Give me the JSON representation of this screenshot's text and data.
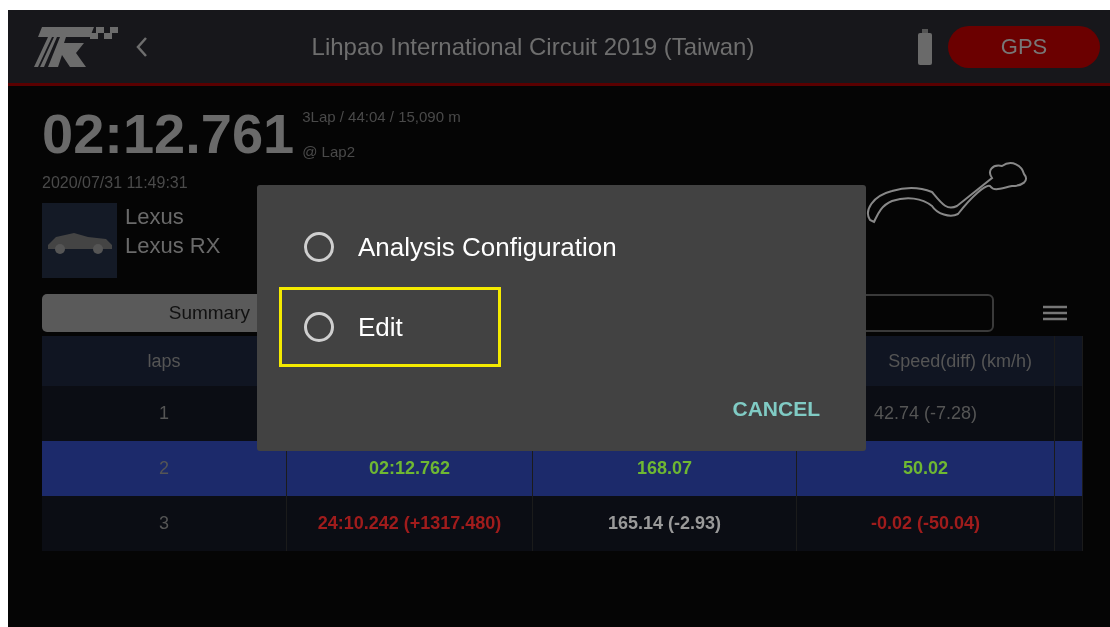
{
  "header": {
    "title": "Lihpao International Circuit 2019 (Taiwan)",
    "gps_button": "GPS"
  },
  "session": {
    "best_time": "02:12.761",
    "summary": "3Lap / 44:04 / 15,090 m",
    "best_lap": "@ Lap2",
    "date": "2020/07/31 11:49:31",
    "make": "Lexus",
    "model": "Lexus RX"
  },
  "tabs": [
    {
      "label": "Summary",
      "selected": true
    },
    {
      "selected": false
    }
  ],
  "table": {
    "columns": [
      "laps",
      null,
      null,
      "Speed(diff) (km/h)",
      null
    ],
    "rows": [
      {
        "selected": false,
        "cells": [
          {
            "text": "1"
          },
          null,
          null,
          {
            "text": "42.74 (-7.28)"
          },
          null
        ]
      },
      {
        "selected": true,
        "cells": [
          {
            "text": "2"
          },
          {
            "text": "02:12.762",
            "color": "#6fb832"
          },
          {
            "text": "168.07",
            "color": "#6fb832"
          },
          {
            "text": "50.02",
            "color": "#6fb832"
          },
          null
        ]
      },
      {
        "selected": false,
        "cells": [
          {
            "text": "3"
          },
          {
            "text": "24:10.242 (+1317.480)",
            "color": "#a01c1c"
          },
          {
            "text": "165.14 (-2.93)",
            "color": "#9a9a9a"
          },
          {
            "text": "-0.02 (-50.04)",
            "color": "#a01c1c"
          },
          null
        ]
      }
    ]
  },
  "dialog": {
    "options": [
      {
        "label": "Analysis Configuration",
        "selected": false,
        "highlighted": false
      },
      {
        "label": "Edit",
        "selected": false,
        "highlighted": true
      }
    ],
    "cancel_button": "CANCEL"
  }
}
